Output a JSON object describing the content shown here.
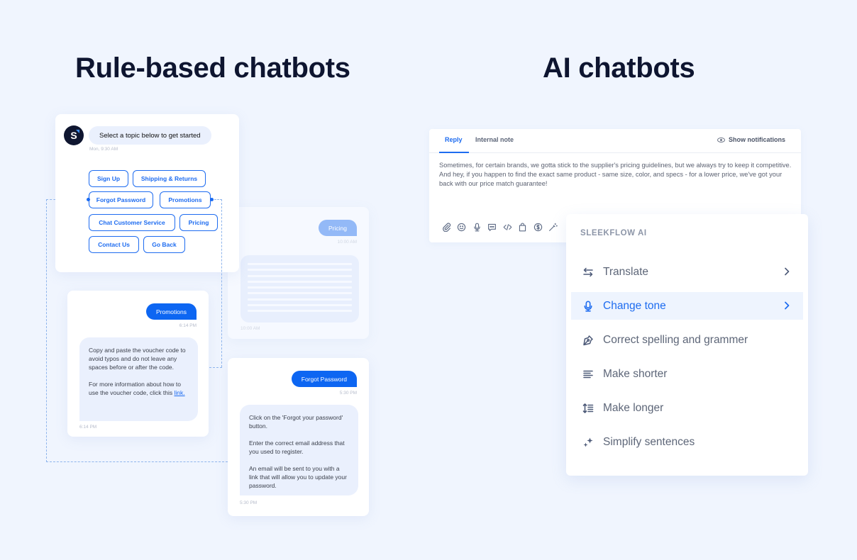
{
  "headings": {
    "left": "Rule-based chatbots",
    "right": "AI chatbots"
  },
  "rule_based": {
    "topic_card": {
      "avatar_letter": "S",
      "greeting": "Select a topic below to get started",
      "greeting_time": "Mon, 9:30 AM",
      "topics": [
        "Sign Up",
        "Shipping & Returns",
        "Forgot Password",
        "Promotions",
        "Chat Customer Service",
        "Pricing",
        "Contact Us",
        "Go Back"
      ]
    },
    "promotions_card": {
      "user_message": "Promotions",
      "user_time": "6:14 PM",
      "bot_paragraph_1": "Copy and paste the voucher code to avoid typos and do not leave any spaces before or after the code.",
      "bot_paragraph_2_prefix": "For more information about how to use the voucher code, click this ",
      "bot_link": "link.",
      "bot_time": "6:14 PM"
    },
    "pricing_card": {
      "user_message": "Pricing",
      "user_time": "10:00 AM",
      "bot_time": "10:00 AM",
      "skeleton_line_count": 9
    },
    "forgot_card": {
      "user_message": "Forgot Password",
      "user_time": "5:30 PM",
      "bot_paragraphs": [
        "Click on the 'Forgot your password' button.",
        "Enter the correct email address that you used to register.",
        "An email will be sent to you with a link that will allow you to update your password."
      ],
      "bot_time": "5:30 PM"
    }
  },
  "ai": {
    "composer": {
      "tabs": [
        {
          "label": "Reply",
          "active": true
        },
        {
          "label": "Internal note",
          "active": false
        }
      ],
      "show_notifications": "Show notifications",
      "message": "Sometimes, for certain brands, we gotta stick to the supplier's pricing guidelines, but we always try to keep it competitive. And hey, if you happen to find the exact same product - same size, color, and specs - for a lower price, we've got your back with our price match guarantee!",
      "toolbar_icons": [
        "paperclip-icon",
        "emoji-icon",
        "microphone-icon",
        "chat-template-icon",
        "code-icon",
        "shopping-bag-icon",
        "dollar-coin-icon",
        "magic-wand-icon"
      ]
    },
    "menu": {
      "title": "SLEEKFLOW AI",
      "items": [
        {
          "label": "Translate",
          "icon": "translate-arrows-icon",
          "has_submenu": true,
          "active": false
        },
        {
          "label": "Change tone",
          "icon": "microphone-icon",
          "has_submenu": true,
          "active": true
        },
        {
          "label": "Correct spelling and grammer",
          "icon": "pen-nib-icon",
          "has_submenu": false,
          "active": false
        },
        {
          "label": "Make shorter",
          "icon": "align-left-icon",
          "has_submenu": false,
          "active": false
        },
        {
          "label": "Make longer",
          "icon": "line-height-icon",
          "has_submenu": false,
          "active": false
        },
        {
          "label": "Simplify sentences",
          "icon": "sparkles-icon",
          "has_submenu": false,
          "active": false
        }
      ]
    }
  },
  "colors": {
    "background": "#f0f5fe",
    "accent": "#1e6cf0",
    "user_bubble": "#0d66f2",
    "bot_bubble": "#eaf0fd",
    "heading": "#0e1530"
  }
}
